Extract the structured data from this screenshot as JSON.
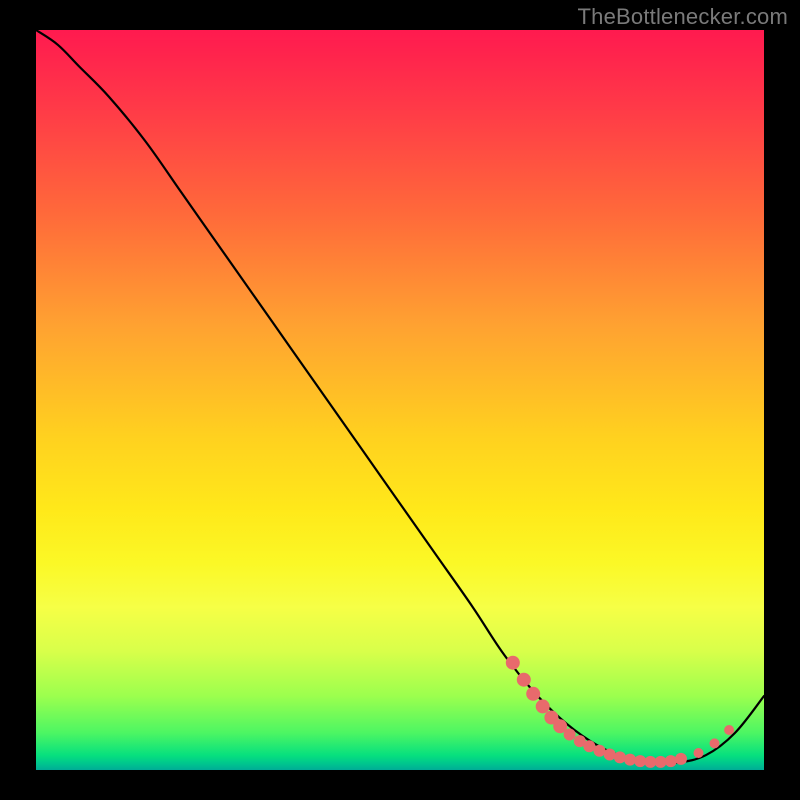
{
  "attribution": "TheBottlenecker.com",
  "chart_data": {
    "type": "line",
    "title": "",
    "xlabel": "",
    "ylabel": "",
    "xlim": [
      0,
      100
    ],
    "ylim": [
      0,
      100
    ],
    "grid": false,
    "series": [
      {
        "name": "curve",
        "x": [
          0,
          3,
          6,
          10,
          15,
          20,
          25,
          30,
          35,
          40,
          45,
          50,
          55,
          60,
          64,
          68,
          72,
          76,
          80,
          84,
          88,
          92,
          96,
          100
        ],
        "y": [
          100,
          98,
          95,
          91,
          85,
          78,
          71,
          64,
          57,
          50,
          43,
          36,
          29,
          22,
          16,
          11,
          7,
          4,
          2,
          1,
          1,
          2,
          5,
          10
        ]
      }
    ],
    "markers": {
      "name": "highlight-points",
      "color": "#e86a6c",
      "points": [
        {
          "x": 65.5,
          "y": 14.5,
          "r": 7
        },
        {
          "x": 67.0,
          "y": 12.2,
          "r": 7
        },
        {
          "x": 68.3,
          "y": 10.3,
          "r": 7
        },
        {
          "x": 69.6,
          "y": 8.6,
          "r": 7
        },
        {
          "x": 70.8,
          "y": 7.1,
          "r": 7
        },
        {
          "x": 72.0,
          "y": 5.9,
          "r": 7
        },
        {
          "x": 73.3,
          "y": 4.8,
          "r": 6
        },
        {
          "x": 74.7,
          "y": 3.9,
          "r": 6
        },
        {
          "x": 76.0,
          "y": 3.2,
          "r": 6
        },
        {
          "x": 77.4,
          "y": 2.6,
          "r": 6
        },
        {
          "x": 78.8,
          "y": 2.1,
          "r": 6
        },
        {
          "x": 80.2,
          "y": 1.7,
          "r": 6
        },
        {
          "x": 81.6,
          "y": 1.4,
          "r": 6
        },
        {
          "x": 83.0,
          "y": 1.2,
          "r": 6
        },
        {
          "x": 84.4,
          "y": 1.1,
          "r": 6
        },
        {
          "x": 85.8,
          "y": 1.1,
          "r": 6
        },
        {
          "x": 87.2,
          "y": 1.2,
          "r": 6
        },
        {
          "x": 88.6,
          "y": 1.5,
          "r": 6
        },
        {
          "x": 91.0,
          "y": 2.3,
          "r": 5
        },
        {
          "x": 93.2,
          "y": 3.6,
          "r": 5
        },
        {
          "x": 95.2,
          "y": 5.4,
          "r": 5
        }
      ]
    },
    "background_gradient_stops": [
      {
        "pos": 0.0,
        "color": "#ff1a4f"
      },
      {
        "pos": 0.5,
        "color": "#ffd11f"
      },
      {
        "pos": 0.8,
        "color": "#f6ff46"
      },
      {
        "pos": 0.95,
        "color": "#4cf663"
      },
      {
        "pos": 1.0,
        "color": "#00ac96"
      }
    ]
  }
}
